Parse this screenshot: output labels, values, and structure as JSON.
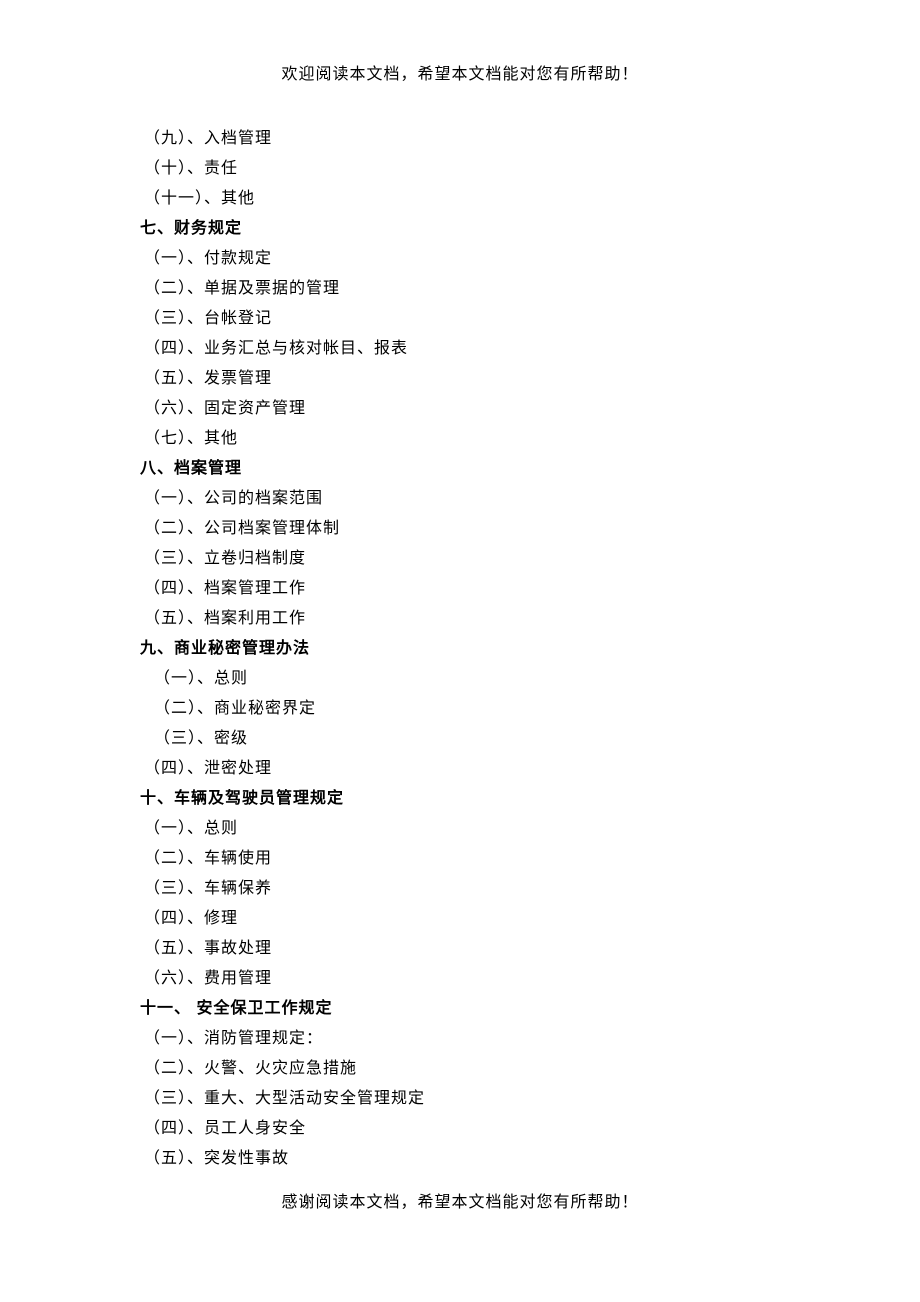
{
  "header": "欢迎阅读本文档，希望本文档能对您有所帮助！",
  "footer": "感谢阅读本文档，希望本文档能对您有所帮助！",
  "lines": [
    {
      "text": "（九）、入档管理",
      "cls": "indent1"
    },
    {
      "text": "（十）、责任",
      "cls": "indent1"
    },
    {
      "text": "（十一）、其他",
      "cls": "indent1"
    },
    {
      "text": "七、财务规定",
      "cls": "heading"
    },
    {
      "text": "（一）、付款规定",
      "cls": "indent1"
    },
    {
      "text": "（二）、单据及票据的管理",
      "cls": "indent1"
    },
    {
      "text": "（三）、台帐登记",
      "cls": "indent1"
    },
    {
      "text": "（四）、业务汇总与核对帐目、报表",
      "cls": "indent1"
    },
    {
      "text": "（五）、发票管理",
      "cls": "indent1"
    },
    {
      "text": "（六）、固定资产管理",
      "cls": "indent1"
    },
    {
      "text": "（七）、其他",
      "cls": "indent1"
    },
    {
      "text": "八、档案管理",
      "cls": "heading"
    },
    {
      "text": "（一）、公司的档案范围",
      "cls": "indent1"
    },
    {
      "text": "（二）、公司档案管理体制",
      "cls": "indent1"
    },
    {
      "text": "（三）、立卷归档制度",
      "cls": "indent1"
    },
    {
      "text": "（四）、档案管理工作",
      "cls": "indent1"
    },
    {
      "text": "（五）、档案利用工作",
      "cls": "indent1"
    },
    {
      "text": "九、商业秘密管理办法",
      "cls": "heading"
    },
    {
      "text": "（一）、总则",
      "cls": "indent2"
    },
    {
      "text": "（二）、商业秘密界定",
      "cls": "indent2"
    },
    {
      "text": "（三）、密级",
      "cls": "indent2"
    },
    {
      "text": "（四）、泄密处理",
      "cls": "indent1"
    },
    {
      "text": "十、车辆及驾驶员管理规定",
      "cls": "heading"
    },
    {
      "text": "（一）、总则",
      "cls": "indent1"
    },
    {
      "text": "（二）、车辆使用",
      "cls": "indent1"
    },
    {
      "text": "（三）、车辆保养",
      "cls": "indent1"
    },
    {
      "text": "（四）、修理",
      "cls": "indent1"
    },
    {
      "text": "（五）、事故处理",
      "cls": "indent1"
    },
    {
      "text": "（六）、费用管理",
      "cls": "indent1"
    },
    {
      "text": "十一、 安全保卫工作规定",
      "cls": "heading"
    },
    {
      "text": "（一）、消防管理规定：",
      "cls": "indent1"
    },
    {
      "text": "（二）、火警、火灾应急措施",
      "cls": "indent1"
    },
    {
      "text": "（三）、重大、大型活动安全管理规定",
      "cls": "indent1"
    },
    {
      "text": "（四）、员工人身安全",
      "cls": "indent1"
    },
    {
      "text": "（五）、突发性事故",
      "cls": "indent1"
    }
  ]
}
